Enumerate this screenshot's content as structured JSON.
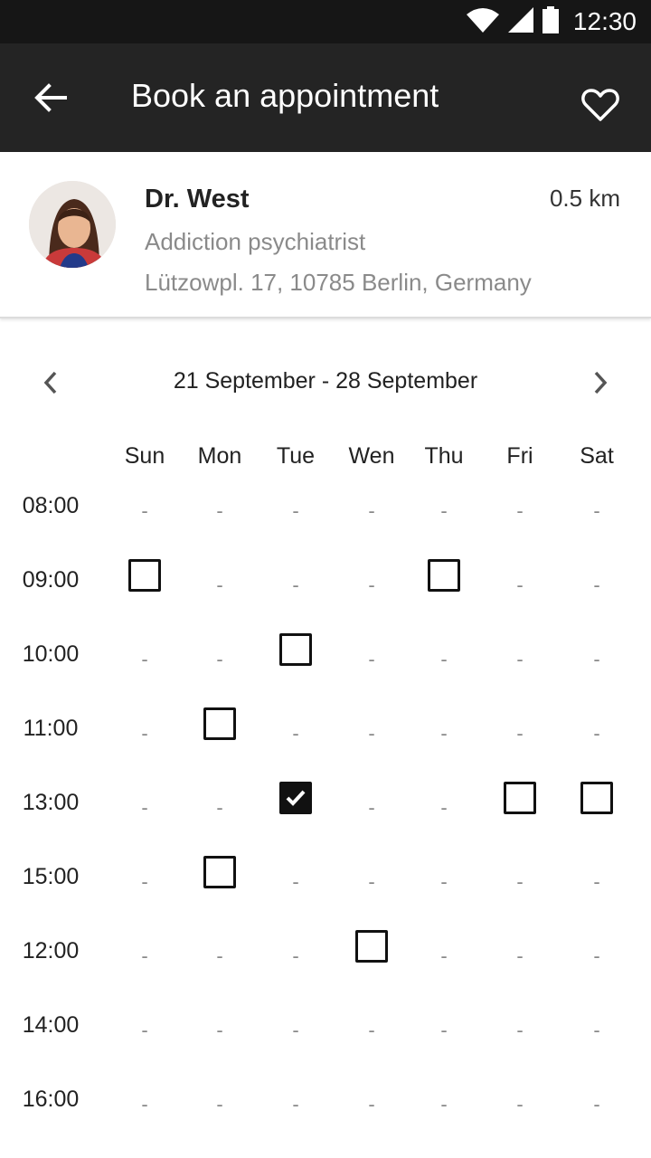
{
  "status_bar": {
    "time": "12:30"
  },
  "app_bar": {
    "title": "Book an appointment"
  },
  "doctor": {
    "name": "Dr. West",
    "distance": "0.5 km",
    "specialty": "Addiction psychiatrist",
    "address": "Lützowpl. 17, 10785 Berlin, Germany"
  },
  "schedule": {
    "week_range": "21 September - 28 September",
    "days": [
      "Sun",
      "Mon",
      "Tue",
      "Wen",
      "Thu",
      "Fri",
      "Sat"
    ],
    "times": [
      "08:00",
      "09:00",
      "10:00",
      "11:00",
      "13:00",
      "15:00",
      "12:00",
      "14:00",
      "16:00"
    ],
    "unavailable_symbol": "-",
    "slots": [
      {
        "time": "09:00",
        "day": "Sun",
        "selected": false
      },
      {
        "time": "09:00",
        "day": "Thu",
        "selected": false
      },
      {
        "time": "10:00",
        "day": "Tue",
        "selected": false
      },
      {
        "time": "11:00",
        "day": "Mon",
        "selected": false
      },
      {
        "time": "13:00",
        "day": "Tue",
        "selected": true
      },
      {
        "time": "13:00",
        "day": "Fri",
        "selected": false
      },
      {
        "time": "13:00",
        "day": "Sat",
        "selected": false
      },
      {
        "time": "15:00",
        "day": "Mon",
        "selected": false
      },
      {
        "time": "12:00",
        "day": "Wen",
        "selected": false
      }
    ]
  },
  "colors": {
    "app_bar": "#242424",
    "status_bar": "#161616",
    "secondary_text": "#8a8a8a"
  }
}
